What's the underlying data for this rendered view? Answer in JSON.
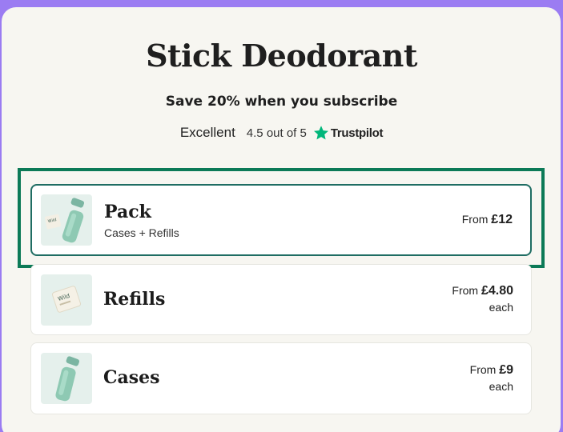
{
  "page": {
    "title": "Stick Deodorant",
    "subtitle": "Save 20% when you subscribe"
  },
  "rating": {
    "label": "Excellent",
    "score": "4.5 out of 5",
    "provider": "Trustpilot",
    "star_icon": "star-icon",
    "star_color": "#00b67a"
  },
  "products": [
    {
      "name": "Pack",
      "description": "Cases + Refills",
      "price_prefix": "From",
      "price": "£12",
      "price_suffix": "",
      "selected": true,
      "image_icon": "pack-product-image"
    },
    {
      "name": "Refills",
      "description": "",
      "price_prefix": "From",
      "price": "£4.80",
      "price_suffix": "each",
      "selected": false,
      "image_icon": "refill-product-image"
    },
    {
      "name": "Cases",
      "description": "",
      "price_prefix": "From",
      "price": "£9",
      "price_suffix": "each",
      "selected": false,
      "image_icon": "case-product-image"
    }
  ],
  "colors": {
    "background": "#9b7cf2",
    "panel": "#f7f6f1",
    "highlight_border": "#0c7a57",
    "selected_card_border": "#1f6d63",
    "thumb_background": "#e5f0ec"
  }
}
